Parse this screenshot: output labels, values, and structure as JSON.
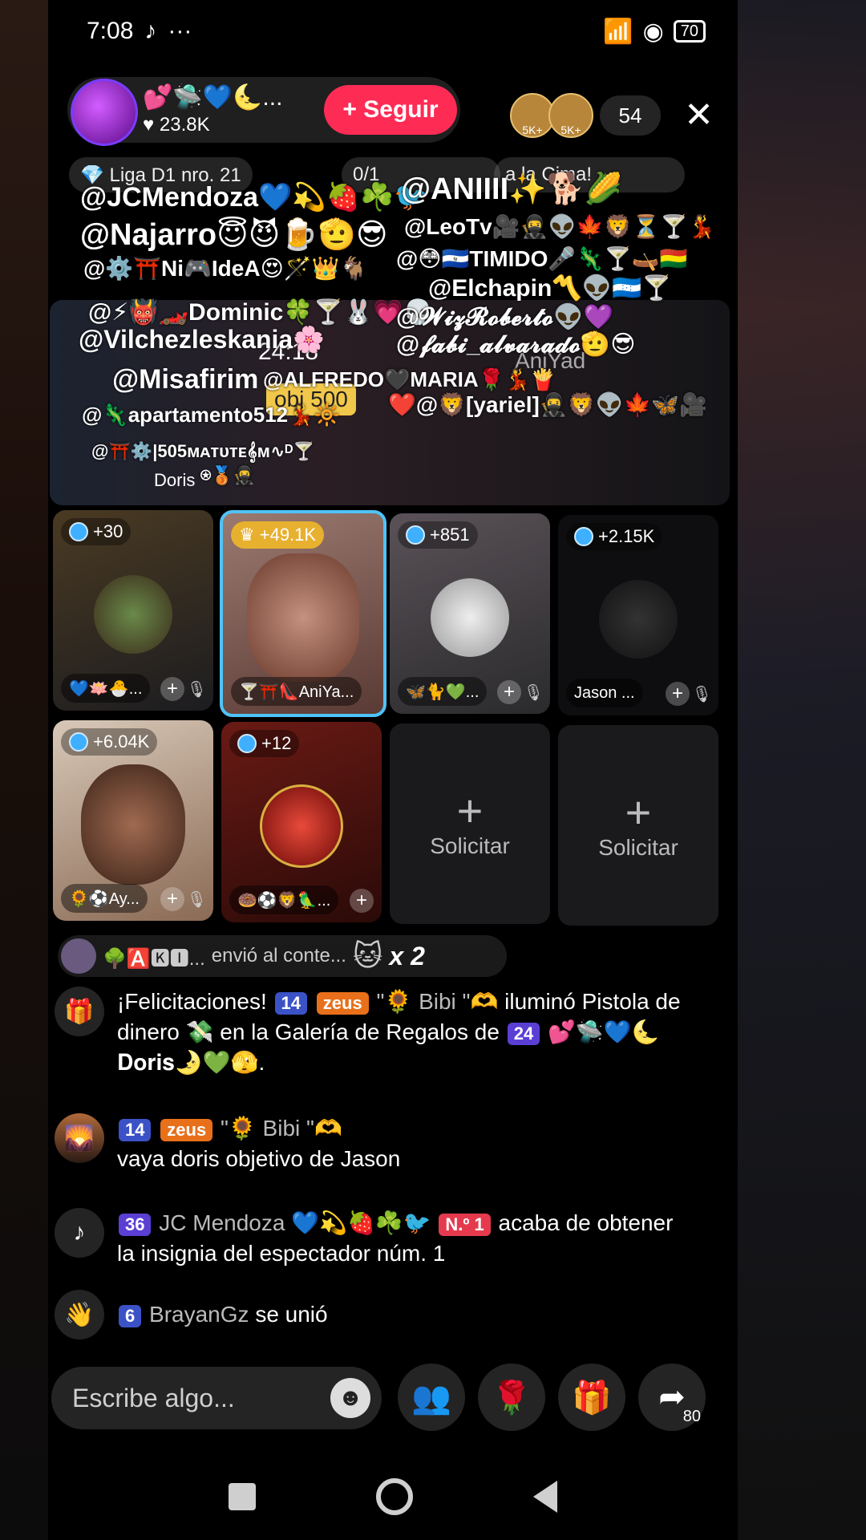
{
  "status": {
    "time": "7:08",
    "tiktok_glyph": "♪",
    "dots": "···",
    "signal": "📶",
    "wifi": "◉",
    "battery": "70"
  },
  "host": {
    "name": "💕🛸💙🌜...",
    "likes": "♥ 23.8K",
    "follow_label": "+ Seguir"
  },
  "viewers": {
    "count": "54",
    "av1": "5K+",
    "av2": "5K+",
    "close": "✕"
  },
  "pills": {
    "league": "💎 Liga D1 nro. 21",
    "progress": "0/1",
    "goal": "a la Cima!"
  },
  "mentions": [
    "@JCMendoza💙💫🍓☘️🐦",
    "@ANIIII✨🐕🌽",
    "@Najarro😇😈🍺🫡😎",
    "@LeoTv🎥🥷👽🍁🦁⏳🍸💃",
    "@⚙️⛩️Ni🎮IdeA😍🪄👑🐐",
    "@😳🇸🇻TIMIDO🎤🦎🍸🛶🇧🇴",
    "@Elchapin〽️👽🇭🇳🍸",
    "@⚡👹🏎️Dominic🍀🍸🐰💗💀",
    "@𝓦𝓲𝔃𝓡𝓸𝓫𝓮𝓻𝓽𝓸👽💜",
    "@Vilchezleskania🌸",
    "@𝓯𝓪𝓫𝓲_𝓪𝓵𝓿𝓪𝓻𝓪𝓭𝓸🫡😎",
    "@Misafirim",
    "@ALFREDO🖤MARIA🌹💃🍟",
    "@🦎apartamento512💃🔆",
    "❤️@🦁[yariel]🥷🦁👽🍁🦋🎥",
    "@⛩️⚙️|505ᴍᴀᴛᴜᴛᴇ𝄞ᴍ∿ᴰ🍸",
    "⍟🥉🥷"
  ],
  "stage": {
    "score": "24:18",
    "objective": "obj 500",
    "label_name": "Doris",
    "player_label": "AniYad"
  },
  "tiles": [
    {
      "score": "+30",
      "name": "💙🪷🐣..."
    },
    {
      "score": "+49.1K",
      "name": "🍸⛩️👠AniYa..."
    },
    {
      "score": "+851",
      "name": "🦋🐈💚..."
    },
    {
      "score": "+2.15K",
      "name": "Jason ..."
    },
    {
      "score": "+6.04K",
      "name": "🌻⚽Ay..."
    },
    {
      "score": "+12",
      "name": "🍩⚽🦁🦜..."
    },
    {
      "label": "Solicitar",
      "plus": "+"
    },
    {
      "label": "Solicitar",
      "plus": "+"
    }
  ],
  "gift_bar": {
    "user": "🌳🅰️🅺️🅸️...",
    "text": "envió al conte...",
    "gift": "🐱",
    "count": "x 2"
  },
  "chat": [
    {
      "icon": "🎁",
      "lead": "¡Felicitaciones!",
      "lvl": "14",
      "fan": "zeus",
      "user": "\"🌻 Bibi \"🫶",
      "body": "iluminó Pistola de dinero 💸 en la Galería de Regalos de",
      "lvl2": "24",
      "tail": "💕🛸💙🌜𝐃𝐨𝐫𝐢𝐬🌛💚🫣."
    },
    {
      "icon": "🌄",
      "lvl": "14",
      "fan": "zeus",
      "user": "\"🌻 Bibi \"🫶",
      "body": "vaya doris objetivo de Jason"
    },
    {
      "icon": "♪",
      "lvl": "36",
      "user": "JC Mendoza 💙💫🍓☘️🐦",
      "rank": "N.º 1",
      "body": "acaba de obtener la insignia del espectador núm. 1"
    },
    {
      "icon": "👋",
      "lvl": "6",
      "user": "BrayanGz",
      "body": "se unió"
    }
  ],
  "bottom": {
    "placeholder": "Escribe algo...",
    "emoji": "☻",
    "share_count": "80",
    "i1": "👥",
    "i2": "🌹",
    "i3": "🎁",
    "i4": "➦"
  }
}
